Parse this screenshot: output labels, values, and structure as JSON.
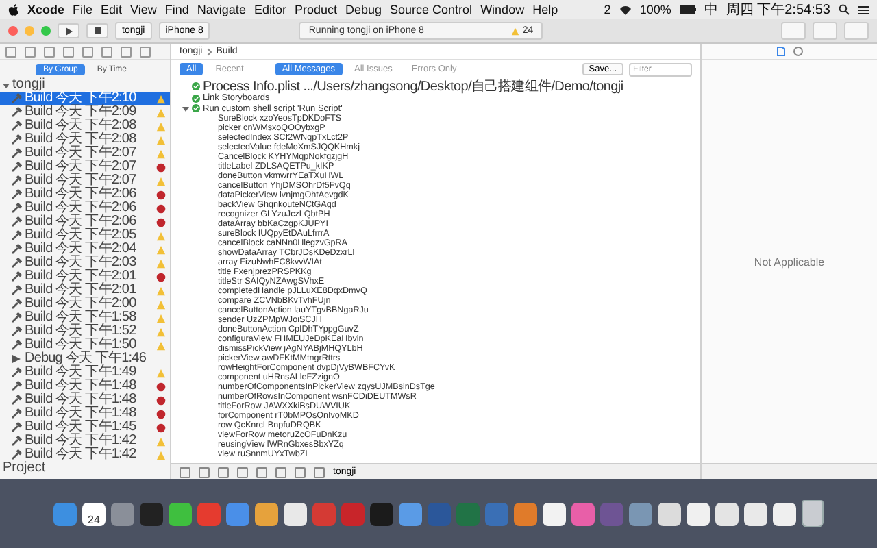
{
  "menu_bar": {
    "app": "Xcode",
    "items": [
      "File",
      "Edit",
      "View",
      "Find",
      "Navigate",
      "Editor",
      "Product",
      "Debug",
      "Source Control",
      "Window",
      "Help"
    ],
    "badge": "2",
    "battery": "100%",
    "input": "中",
    "clock": "周四 下午2:54:53"
  },
  "toolbar": {
    "scheme": "tongji",
    "device": "iPhone 8",
    "status": "Running tongji on iPhone 8",
    "warnings": "24"
  },
  "navigator": {
    "filters": [
      {
        "label": "By Group",
        "selected": true
      },
      {
        "label": "By Time",
        "selected": false
      }
    ],
    "project": "tongji",
    "footer": "Project",
    "items": [
      {
        "kind": "build",
        "label": "Build 今天 下午2:10",
        "warning": true,
        "error": false,
        "selected": true
      },
      {
        "kind": "build",
        "label": "Build 今天 下午2:09",
        "warning": true,
        "error": false,
        "selected": false
      },
      {
        "kind": "build",
        "label": "Build 今天 下午2:08",
        "warning": true,
        "error": false,
        "selected": false
      },
      {
        "kind": "build",
        "label": "Build 今天 下午2:08",
        "warning": true,
        "error": false,
        "selected": false
      },
      {
        "kind": "build",
        "label": "Build 今天 下午2:07",
        "warning": true,
        "error": false,
        "selected": false
      },
      {
        "kind": "build",
        "label": "Build 今天 下午2:07",
        "warning": false,
        "error": true,
        "selected": false
      },
      {
        "kind": "build",
        "label": "Build 今天 下午2:07",
        "warning": true,
        "error": false,
        "selected": false
      },
      {
        "kind": "build",
        "label": "Build 今天 下午2:06",
        "warning": false,
        "error": true,
        "selected": false
      },
      {
        "kind": "build",
        "label": "Build 今天 下午2:06",
        "warning": false,
        "error": true,
        "selected": false
      },
      {
        "kind": "build",
        "label": "Build 今天 下午2:06",
        "warning": false,
        "error": true,
        "selected": false
      },
      {
        "kind": "build",
        "label": "Build 今天 下午2:05",
        "warning": true,
        "error": false,
        "selected": false
      },
      {
        "kind": "build",
        "label": "Build 今天 下午2:04",
        "warning": true,
        "error": false,
        "selected": false
      },
      {
        "kind": "build",
        "label": "Build 今天 下午2:03",
        "warning": true,
        "error": false,
        "selected": false
      },
      {
        "kind": "build",
        "label": "Build 今天 下午2:01",
        "warning": false,
        "error": true,
        "selected": false
      },
      {
        "kind": "build",
        "label": "Build 今天 下午2:01",
        "warning": true,
        "error": false,
        "selected": false
      },
      {
        "kind": "build",
        "label": "Build 今天 下午2:00",
        "warning": true,
        "error": false,
        "selected": false
      },
      {
        "kind": "build",
        "label": "Build 今天 下午1:58",
        "warning": true,
        "error": false,
        "selected": false
      },
      {
        "kind": "build",
        "label": "Build 今天 下午1:52",
        "warning": true,
        "error": false,
        "selected": false
      },
      {
        "kind": "build",
        "label": "Build 今天 下午1:50",
        "warning": true,
        "error": false,
        "selected": false
      },
      {
        "kind": "debug",
        "label": "Debug 今天 下午1:46",
        "warning": false,
        "error": false,
        "selected": false
      },
      {
        "kind": "build",
        "label": "Build 今天 下午1:49",
        "warning": true,
        "error": false,
        "selected": false
      },
      {
        "kind": "build",
        "label": "Build 今天 下午1:48",
        "warning": false,
        "error": true,
        "selected": false
      },
      {
        "kind": "build",
        "label": "Build 今天 下午1:48",
        "warning": false,
        "error": true,
        "selected": false
      },
      {
        "kind": "build",
        "label": "Build 今天 下午1:48",
        "warning": false,
        "error": true,
        "selected": false
      },
      {
        "kind": "build",
        "label": "Build 今天 下午1:45",
        "warning": false,
        "error": true,
        "selected": false
      },
      {
        "kind": "build",
        "label": "Build 今天 下午1:42",
        "warning": true,
        "error": false,
        "selected": false
      },
      {
        "kind": "build",
        "label": "Build 今天 下午1:42",
        "warning": true,
        "error": false,
        "selected": false
      }
    ]
  },
  "editor": {
    "breadcrumb": [
      "tongji",
      "Build"
    ],
    "scope_tabs": [
      {
        "label": "All",
        "selected": true
      },
      {
        "label": "Recent",
        "selected": false
      }
    ],
    "message_tabs": [
      {
        "label": "All Messages",
        "selected": true
      },
      {
        "label": "All Issues",
        "selected": false
      },
      {
        "label": "Errors Only",
        "selected": false
      }
    ],
    "save": "Save...",
    "filter_placeholder": "Filter",
    "steps": [
      {
        "label": "Process Info.plist .../Users/zhangsong/Desktop/自己搭建组件/Demo/tongji",
        "expanded": false
      },
      {
        "label": "Link Storyboards",
        "expanded": false
      },
      {
        "label": "Run custom shell script 'Run Script'",
        "expanded": true
      }
    ],
    "output": [
      "SureBlock xzoYeosTpDKDoFTS",
      "picker cnWMsxoQOOybxgP",
      "selectedIndex SCf2WNqpTxLct2P",
      "selectedValue fdeMoXmSJQQKHmkj",
      "CancelBlock KYHYMqpNokfgzjgH",
      "titleLabel ZDLSAQETPu_kIKP",
      "doneButton vkmwrrYEaTXuHWL",
      "cancelButton YhjDMSOhrDf5FvQq",
      "dataPickerView lvnjmgOhtAevgdK",
      "backView GhqnkouteNCtGAqd",
      "recognizer GLYzuJczLQbtPH",
      "dataArray bbKaCzgpKJUPYI",
      "sureBlock IUQpyEtDAuLfrrrA",
      "cancelBlock caNNn0HlegzvGpRA",
      "showDataArray TCbrJDsKDeDzxrLl",
      "array FizuNwhEC8kvvWIAt",
      "title FxenjprezPRSPKKg",
      "titleStr SAIQyNZAwgSVhxE",
      "completedHandle pJLLuXE8DqxDmvQ",
      "compare ZCVNbBKvTvhFUjn",
      "cancelButtonAction lauYTgvBBNgaRJu",
      "sender UzZPMpWJoiSCJH",
      "doneButtonAction CpIDhTYppgGuvZ",
      "configuraView FHMEUJeDpKEaHbvin",
      "dismissPickView jAgNYABjMHQYLbH",
      "pickerView awDFKtMMtngrRttrs",
      "rowHeightForComponent dvpDjVyBWBFCYvK",
      "component uHRnsALleFZzignO",
      "numberOfComponentsInPickerView zqysUJMBsinDsTge",
      "numberOfRowsInComponent wsnFCDiDEUTMWsR",
      "titleForRow JAWXXkiBsDUWVIUK",
      "forComponent rT0bMPOsOnIvoMKD",
      "row QcKnrcLBnpfuDRQBK",
      "viewForRow metoruZcOFuDnKzu",
      "reusingView lWRnGbxesBbxYZq",
      "view ruSnnmUYxTwbZI"
    ],
    "debug_target": "tongji"
  },
  "inspector": {
    "message": "Not Applicable"
  },
  "dock": [
    {
      "kind": "app",
      "color": "#3d8fe0"
    },
    {
      "kind": "calendar",
      "label": "24"
    },
    {
      "kind": "app",
      "color": "#8a8f99"
    },
    {
      "kind": "app",
      "color": "#222222"
    },
    {
      "kind": "app",
      "color": "#3fbf3f"
    },
    {
      "kind": "app",
      "color": "#e53b2f"
    },
    {
      "kind": "app",
      "color": "#4a8fe8"
    },
    {
      "kind": "app",
      "color": "#e6a23c"
    },
    {
      "kind": "app",
      "color": "#e8e8e8"
    },
    {
      "kind": "app",
      "color": "#d43a34"
    },
    {
      "kind": "app",
      "color": "#c8252a"
    },
    {
      "kind": "app",
      "color": "#1b1b1b"
    },
    {
      "kind": "app",
      "color": "#5a9be6"
    },
    {
      "kind": "app",
      "color": "#2b579a"
    },
    {
      "kind": "app",
      "color": "#217346"
    },
    {
      "kind": "app",
      "color": "#3a6fb5"
    },
    {
      "kind": "app",
      "color": "#e07b2a"
    },
    {
      "kind": "app",
      "color": "#f2f2f2"
    },
    {
      "kind": "app",
      "color": "#e85fa8"
    },
    {
      "kind": "app",
      "color": "#6e5494"
    },
    {
      "kind": "app",
      "color": "#7a96b3"
    },
    {
      "kind": "app",
      "color": "#dcdcdc"
    },
    {
      "kind": "app",
      "color": "#f0f0f0"
    },
    {
      "kind": "app",
      "color": "#e4e4e4"
    },
    {
      "kind": "app",
      "color": "#e9e9e9"
    },
    {
      "kind": "app",
      "color": "#efefef"
    },
    {
      "kind": "trash",
      "color": "#c9ccd1"
    }
  ]
}
